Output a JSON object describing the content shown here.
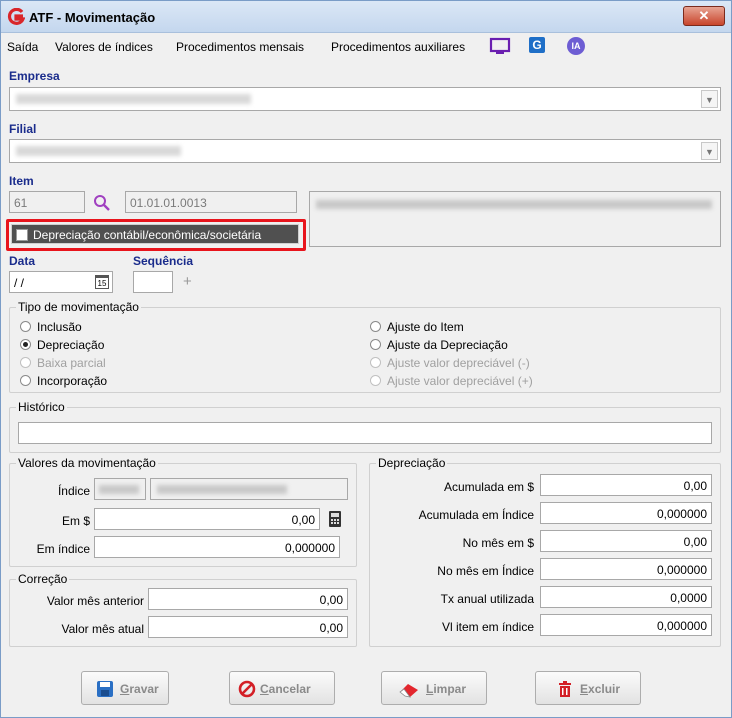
{
  "window": {
    "title": "ATF - Movimentação",
    "close_label": "✕"
  },
  "menu": {
    "items": [
      "Saída",
      "Valores de índices",
      "Procedimentos mensais",
      "Procedimentos auxiliares"
    ],
    "ia_badge": "IA",
    "g_badge": "G"
  },
  "empresa": {
    "label": "Empresa"
  },
  "filial": {
    "label": "Filial"
  },
  "item": {
    "label": "Item",
    "code": "61",
    "account": "01.01.01.0013"
  },
  "depreciacao_check": {
    "label": "Depreciação contábil/econômica/societária",
    "checked": false
  },
  "data": {
    "label": "Data",
    "value": "/ /",
    "calendar_label": "15"
  },
  "sequencia": {
    "label": "Sequência",
    "value": ""
  },
  "tipo": {
    "title": "Tipo de movimentação",
    "options": [
      {
        "label": "Inclusão",
        "state": "normal"
      },
      {
        "label": "Depreciação",
        "state": "checked"
      },
      {
        "label": "Baixa parcial",
        "state": "disabled"
      },
      {
        "label": "Incorporação",
        "state": "normal"
      },
      {
        "label": "Ajuste do Item",
        "state": "normal"
      },
      {
        "label": "Ajuste da Depreciação",
        "state": "normal"
      },
      {
        "label": "Ajuste valor depreciável (-)",
        "state": "disabled"
      },
      {
        "label": "Ajuste valor depreciável (+)",
        "state": "disabled"
      }
    ]
  },
  "historico": {
    "title": "Histórico",
    "value": ""
  },
  "valores": {
    "title": "Valores da movimentação",
    "indice_label": "Índice",
    "em_label": "Em $",
    "em_value": "0,00",
    "em_indice_label": "Em índice",
    "em_indice_value": "0,000000"
  },
  "correcao": {
    "title": "Correção",
    "anterior_label": "Valor mês anterior",
    "anterior_value": "0,00",
    "atual_label": "Valor mês atual",
    "atual_value": "0,00"
  },
  "depreciacao": {
    "title": "Depreciação",
    "rows": [
      {
        "label": "Acumulada em $",
        "value": "0,00"
      },
      {
        "label": "Acumulada em Índice",
        "value": "0,000000"
      },
      {
        "label": "No mês em $",
        "value": "0,00"
      },
      {
        "label": "No mês em Índice",
        "value": "0,000000"
      },
      {
        "label": "Tx anual utilizada",
        "value": "0,0000"
      },
      {
        "label": "Vl item em índice",
        "value": "0,000000"
      }
    ]
  },
  "buttons": {
    "gravar": "Gravar",
    "cancelar": "Cancelar",
    "limpar": "Limpar",
    "excluir": "Excluir"
  },
  "colors": {
    "label_blue": "#1a2c8c",
    "highlight_red": "#e8141c",
    "search_purple": "#a040c0"
  }
}
